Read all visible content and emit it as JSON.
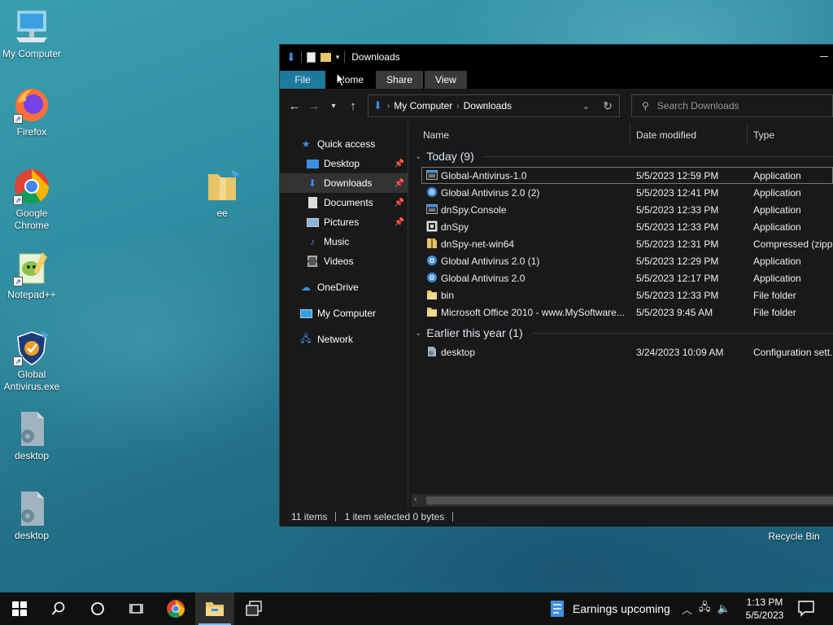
{
  "desktop": {
    "icons": [
      {
        "label": "My Computer",
        "icon": "computer-icon"
      },
      {
        "label": "Firefox",
        "icon": "firefox-icon"
      },
      {
        "label": "Google Chrome",
        "icon": "chrome-icon"
      },
      {
        "label": "Notepad++",
        "icon": "notepadpp-icon"
      },
      {
        "label": "Global Antivirus.exe",
        "icon": "shield-icon"
      },
      {
        "label": "desktop",
        "icon": "config-file-icon"
      },
      {
        "label": "desktop",
        "icon": "config-file-icon"
      },
      {
        "label": "ee",
        "icon": "folder-icon"
      },
      {
        "label": "Recycle Bin",
        "icon": "recycle-bin-icon"
      }
    ]
  },
  "explorer": {
    "title": "Downloads",
    "ribbon_tabs": [
      "File",
      "Home",
      "Share",
      "View"
    ],
    "breadcrumb": [
      "My Computer",
      "Downloads"
    ],
    "search_placeholder": "Search Downloads",
    "nav": {
      "quick_access": "Quick access",
      "items": [
        "Desktop",
        "Downloads",
        "Documents",
        "Pictures",
        "Music",
        "Videos"
      ],
      "onedrive": "OneDrive",
      "my_computer": "My Computer",
      "network": "Network"
    },
    "columns": {
      "name": "Name",
      "date": "Date modified",
      "type": "Type"
    },
    "groups": [
      {
        "label": "Today (9)",
        "files": [
          {
            "name": "Global-Antivirus-1.0",
            "date": "5/5/2023 12:59 PM",
            "type": "Application",
            "icon": "app-icon",
            "selected": true
          },
          {
            "name": "Global Antivirus  2.0 (2)",
            "date": "5/5/2023 12:41 PM",
            "type": "Application",
            "icon": "setup-icon"
          },
          {
            "name": "dnSpy.Console",
            "date": "5/5/2023 12:33 PM",
            "type": "Application",
            "icon": "app-icon"
          },
          {
            "name": "dnSpy",
            "date": "5/5/2023 12:33 PM",
            "type": "Application",
            "icon": "dnspy-icon"
          },
          {
            "name": "dnSpy-net-win64",
            "date": "5/5/2023 12:31 PM",
            "type": "Compressed (zipp...",
            "icon": "zip-icon"
          },
          {
            "name": "Global Antivirus  2.0 (1)",
            "date": "5/5/2023 12:29 PM",
            "type": "Application",
            "icon": "setup-icon"
          },
          {
            "name": "Global Antivirus  2.0",
            "date": "5/5/2023 12:17 PM",
            "type": "Application",
            "icon": "setup-icon"
          },
          {
            "name": "bin",
            "date": "5/5/2023 12:33 PM",
            "type": "File folder",
            "icon": "folder-icon"
          },
          {
            "name": "Microsoft Office 2010 - www.MySoftware...",
            "date": "5/5/2023 9:45 AM",
            "type": "File folder",
            "icon": "folder-icon"
          }
        ]
      },
      {
        "label": "Earlier this year (1)",
        "files": [
          {
            "name": "desktop",
            "date": "3/24/2023 10:09 AM",
            "type": "Configuration sett...",
            "icon": "config-file-icon"
          }
        ]
      }
    ],
    "status": {
      "count": "11 items",
      "selection": "1 item selected  0 bytes"
    }
  },
  "taskbar": {
    "news": "Earnings upcoming",
    "time": "1:13 PM",
    "date": "5/5/2023"
  },
  "colors": {
    "accent": "#1e7a9b",
    "folder": "#e8c46a",
    "taskbar": "#101010"
  }
}
